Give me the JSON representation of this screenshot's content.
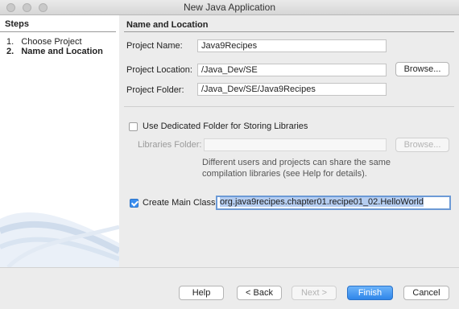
{
  "window": {
    "title": "New Java Application"
  },
  "steps": {
    "header": "Steps",
    "items": [
      {
        "num": "1.",
        "label": "Choose Project"
      },
      {
        "num": "2.",
        "label": "Name and Location"
      }
    ]
  },
  "main": {
    "header": "Name and Location",
    "project_name_label": "Project Name:",
    "project_name_value": "Java9Recipes",
    "project_location_label": "Project Location:",
    "project_location_value": "/Java_Dev/SE",
    "browse_label": "Browse...",
    "project_folder_label": "Project Folder:",
    "project_folder_value": "/Java_Dev/SE/Java9Recipes",
    "dedicated_folder_label": "Use Dedicated Folder for Storing Libraries",
    "dedicated_folder_checked": false,
    "libraries_folder_label": "Libraries Folder:",
    "libraries_folder_value": "",
    "libraries_browse_label": "Browse...",
    "note_line1": "Different users and projects can share the same",
    "note_line2": "compilation libraries (see Help for details).",
    "create_main_label": "Create Main Class",
    "create_main_checked": true,
    "main_class_value": "org.java9recipes.chapter01.recipe01_02.HelloWorld"
  },
  "footer": {
    "help": "Help",
    "back": "< Back",
    "next": "Next >",
    "finish": "Finish",
    "cancel": "Cancel"
  },
  "colors": {
    "accent": "#3a8ef0",
    "selection": "#b5cdf0"
  }
}
